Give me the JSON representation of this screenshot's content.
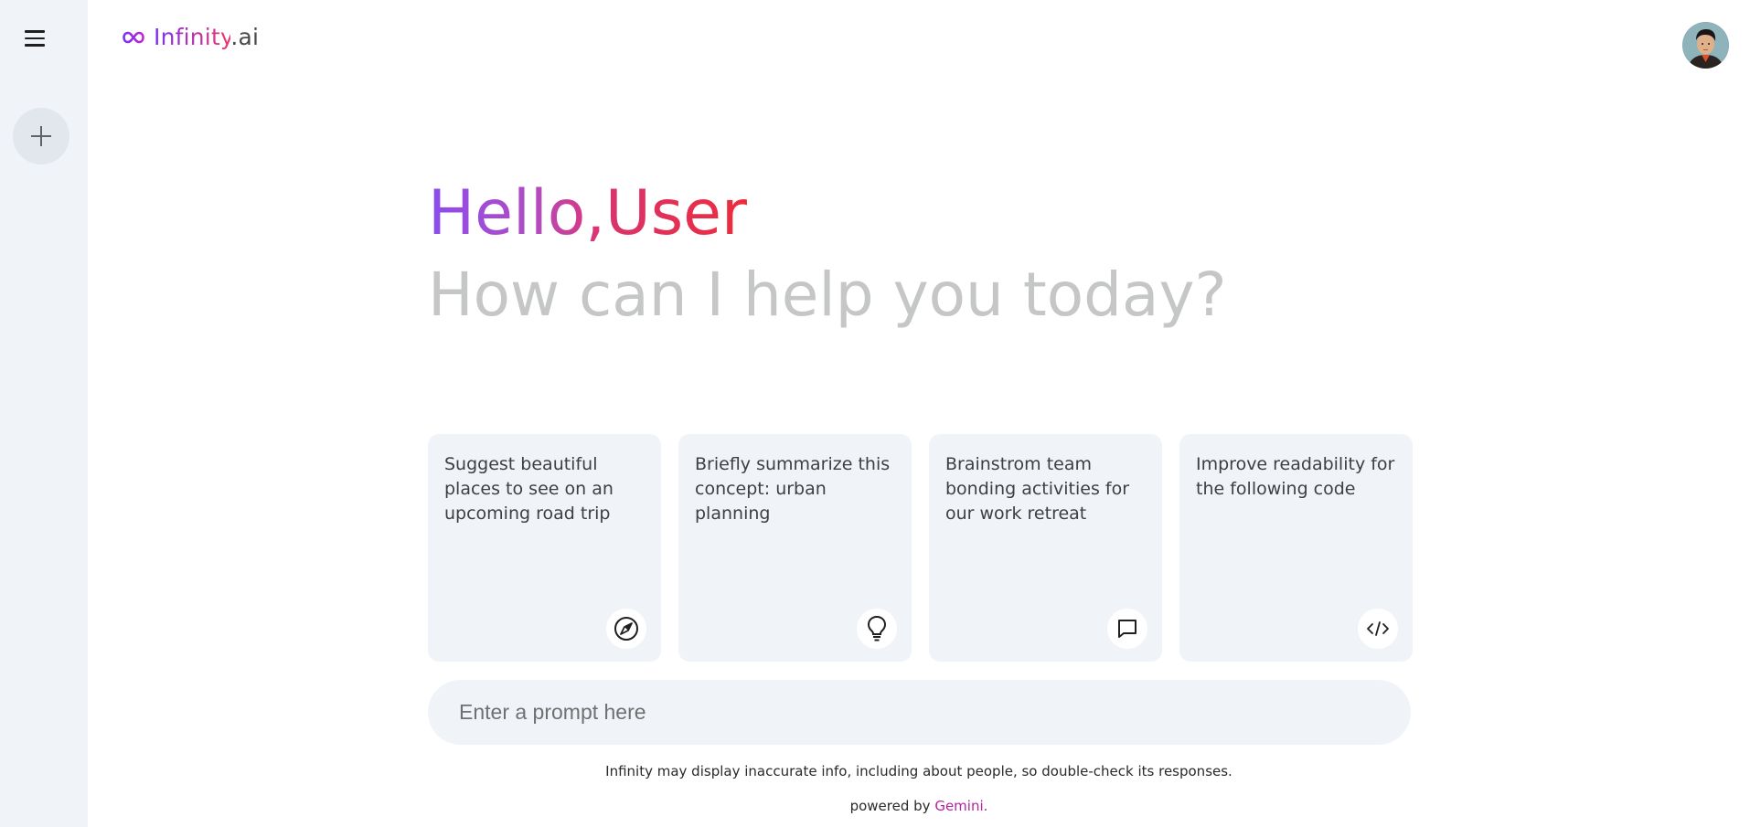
{
  "app": {
    "logo_name": "Infinity",
    "logo_suffix": ".ai"
  },
  "sidebar": {
    "menu_icon": "hamburger-menu-icon",
    "new_chat_icon": "plus-icon"
  },
  "header": {
    "avatar_icon": "user-avatar"
  },
  "hero": {
    "greeting_hello": "Hello,",
    "greeting_user": "User",
    "subtitle": "How can I help you today?"
  },
  "cards": [
    {
      "text": "Suggest beautiful places to see on an upcoming road trip",
      "icon": "compass-icon"
    },
    {
      "text": "Briefly summarize this concept: urban planning",
      "icon": "lightbulb-icon"
    },
    {
      "text": "Brainstrom team bonding activities for our work retreat",
      "icon": "message-icon"
    },
    {
      "text": "Improve readability for the following code",
      "icon": "code-icon"
    }
  ],
  "prompt": {
    "placeholder": "Enter a prompt here",
    "value": ""
  },
  "footer": {
    "disclaimer": "Infinity may display inaccurate info, including about people, so double-check its responses.",
    "powered_by": "powered by",
    "provider": "Gemini."
  },
  "colors": {
    "sidebar_bg": "#f0f4f9",
    "card_bg": "#f0f4f9",
    "gradient_start": "#7b2ff7",
    "gradient_end": "#ee2b3a",
    "subtitle": "#c4c7c5",
    "provider": "#b5249c"
  }
}
